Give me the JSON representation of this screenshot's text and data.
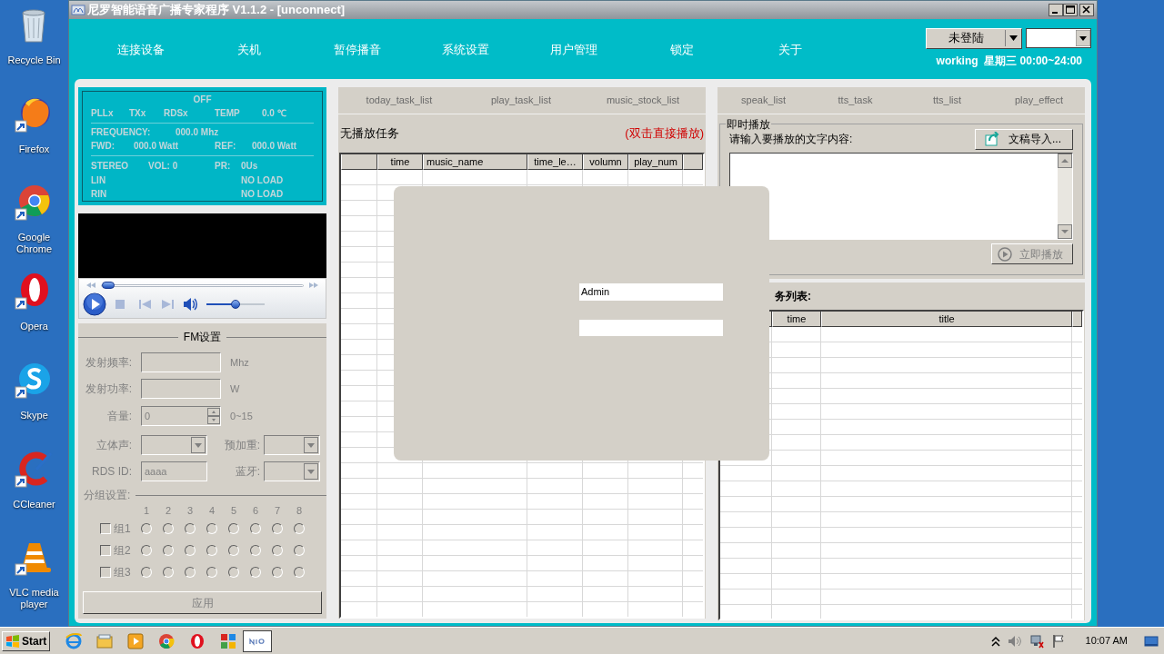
{
  "window": {
    "title": "尼罗智能语音广播专家程序 V1.1.2 - [unconnect]"
  },
  "desktop_icons": [
    {
      "label": "Recycle Bin",
      "kind": "recycle"
    },
    {
      "label": "Firefox",
      "kind": "firefox"
    },
    {
      "label": "Google Chrome",
      "kind": "chrome"
    },
    {
      "label": "Opera",
      "kind": "opera"
    },
    {
      "label": "Skype",
      "kind": "skype"
    },
    {
      "label": "CCleaner",
      "kind": "ccleaner"
    },
    {
      "label": "VLC media player",
      "kind": "vlc"
    }
  ],
  "menu": [
    "连接设备",
    "关机",
    "暂停播音",
    "系统设置",
    "用户管理",
    "锁定",
    "关于"
  ],
  "user_button": "未登陆",
  "status_text": "working  星期三 00:00~24:00",
  "device_status": {
    "power": "OFF",
    "flags": [
      "PLLx",
      "TXx",
      "RDSx"
    ],
    "temp_label": "TEMP",
    "temp": "0.0 ℃",
    "frequency_label": "FREQUENCY:",
    "frequency": "000.0 Mhz",
    "fwd_label": "FWD:",
    "fwd": "000.0 Watt",
    "ref_label": "REF:",
    "ref": "000.0 Watt",
    "stereo": "STEREO",
    "vol": "VOL: 0",
    "pr_label": "PR:",
    "pr": "0Us",
    "lin": "LIN",
    "lin_state": "NO LOAD",
    "rin": "RIN",
    "rin_state": "NO LOAD"
  },
  "player": {
    "seek": {
      "level": 0.03
    },
    "volume": {
      "level": 0.5
    }
  },
  "fm_settings": {
    "title": "FM设置",
    "disabled": true,
    "frequency": {
      "label": "发射频率:",
      "unit": "Mhz"
    },
    "power": {
      "label": "发射功率:",
      "unit": "W"
    },
    "volume": {
      "label": "音量:",
      "value": "0",
      "unit": "0~15"
    },
    "stereo": {
      "label": "立体声:"
    },
    "preemphasis": {
      "label": "预加重:"
    },
    "rds_id": {
      "label": "RDS ID:",
      "value": "aaaa"
    },
    "bluetooth": {
      "label": "蓝牙:"
    },
    "group_title": "分组设置:",
    "channels": [
      "1",
      "2",
      "3",
      "4",
      "5",
      "6",
      "7",
      "8"
    ],
    "groups": [
      {
        "label": "组1",
        "checked": false,
        "radios": [
          false,
          false,
          false,
          false,
          false,
          false,
          false,
          false
        ]
      },
      {
        "label": "组2",
        "checked": false,
        "radios": [
          false,
          false,
          false,
          false,
          false,
          false,
          false,
          false
        ]
      },
      {
        "label": "组3",
        "checked": false,
        "radios": [
          false,
          false,
          false,
          false,
          false,
          false,
          false,
          false
        ]
      }
    ],
    "apply_button": "应用"
  },
  "task_panel": {
    "tabs": [
      {
        "label": "today_task_list",
        "selected": false
      },
      {
        "label": "play_task_list",
        "selected": false
      },
      {
        "label": "music_stock_list",
        "selected": false
      }
    ],
    "status": "无播放任务",
    "hint": "(双击直接播放)",
    "columns": [
      "time",
      "music_name",
      "time_le…",
      "volumn",
      "play_num"
    ]
  },
  "speech_panel": {
    "tabs": [
      {
        "label": "speak_list",
        "selected": false
      },
      {
        "label": "tts_task",
        "selected": false
      },
      {
        "label": "tts_list",
        "selected": false
      },
      {
        "label": "play_effect",
        "selected": false
      }
    ],
    "group_title": "即时播放",
    "prompt": "请输入要播放的文字内容:",
    "import_button": "文稿导入...",
    "play_button": {
      "label": "立即播放",
      "disabled": true
    },
    "list_label": "务列表:",
    "columns": [
      "time",
      "title"
    ]
  },
  "login_dialog": {
    "username": "Admin"
  },
  "taskbar": {
    "start": "Start",
    "clock": "10:07 AM"
  }
}
